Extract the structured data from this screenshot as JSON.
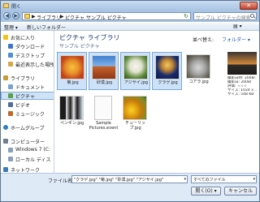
{
  "window": {
    "title": "開く",
    "close_symbol": "✕"
  },
  "nav": {
    "back_icon": "back-arrow-icon",
    "forward_icon": "forward-arrow-icon",
    "back_symbol": "◀",
    "forward_symbol": "▶"
  },
  "address": {
    "crumbs": [
      "ライブラリ",
      "ピクチャ",
      "サンプル ピクチャ"
    ],
    "separators": [
      "▶",
      "▶"
    ],
    "refresh_symbol": "↻"
  },
  "search": {
    "placeholder": "サンプル ピクチャの検索"
  },
  "toolbar": {
    "organize": "整理 ▾",
    "new_folder": "新しいフォルダー",
    "view_symbol": "▤ ▾"
  },
  "sidebar": {
    "items": [
      {
        "label": "お気に入り",
        "icon": "star-icon",
        "color": "#f2c316"
      },
      {
        "label": "ダウンロード",
        "icon": "download-folder-icon",
        "color": "#3c78c8"
      },
      {
        "label": "デスクトップ",
        "icon": "desktop-icon",
        "color": "#4f8fd6"
      },
      {
        "label": "最近表示した場所",
        "icon": "recent-places-icon",
        "color": "#d9a74a"
      },
      {
        "label": "ライブラリ",
        "icon": "library-icon",
        "color": "#c79a3c"
      },
      {
        "label": "ドキュメント",
        "icon": "documents-icon",
        "color": "#7aa3d1"
      },
      {
        "label": "ピクチャ",
        "icon": "pictures-icon",
        "color": "#5aa04b"
      },
      {
        "label": "ビデオ",
        "icon": "videos-icon",
        "color": "#4d6e99"
      },
      {
        "label": "ミュージック",
        "icon": "music-icon",
        "color": "#c06a2a"
      },
      {
        "label": "ホームグループ",
        "icon": "homegroup-icon",
        "color": "#2e7fc5"
      },
      {
        "label": "コンピューター",
        "icon": "computer-icon",
        "color": "#6d7e93"
      },
      {
        "label": "Windows 7 (C:",
        "icon": "drive-icon",
        "color": "#8aa0b8"
      },
      {
        "label": "ローカル ディス",
        "icon": "drive-icon",
        "color": "#8aa0b8"
      },
      {
        "label": "ネットワーク",
        "icon": "network-icon",
        "color": "#3d7ab8"
      }
    ]
  },
  "library": {
    "title": "ピクチャ ライブラリ",
    "subtitle": "サンプル ピクチャ",
    "arrange_label": "並べ替え:",
    "arrange_value": "フォルダー ▾"
  },
  "files": [
    {
      "name": "菊.jpg",
      "selected": true,
      "icon": "flower-thumbnail"
    },
    {
      "name": "砂漠.jpg",
      "selected": true,
      "icon": "desert-thumbnail"
    },
    {
      "name": "アジサイ.jpg",
      "selected": true,
      "icon": "hydrangea-thumbnail"
    },
    {
      "name": "クラゲ.jpg",
      "selected": true,
      "icon": "jellyfish-thumbnail"
    },
    {
      "name": "コアラ.jpg",
      "selected": false,
      "icon": "koala-thumbnail"
    },
    {
      "name": "ペンギン.jpg",
      "selected": false,
      "icon": "penguins-thumbnail"
    },
    {
      "name": "Sample Pictures.event",
      "selected": false,
      "icon": "document-thumbnail"
    },
    {
      "name": "チューリップ.jpg",
      "selected": false,
      "icon": "tulips-thumbnail"
    }
  ],
  "preview": {
    "lines": [
      "撮影日時: 2008/...",
      "撮影日: 2008/",
      "評価: ☆☆☆",
      "サイズ: 1024 x ...",
      "サイズ: 548 KB"
    ]
  },
  "footer": {
    "filename_label": "ファイル名(N):",
    "filename_value": "\"クラゲ.jpg\" \"菊.jpg\" \"砂漠.jpg\" \"アジサイ.jpg\"",
    "filetype_value": "すべてのファイル",
    "dropdown_symbol": "▾",
    "open_label": "開く(O) ▾",
    "cancel_label": "キャンセル"
  }
}
